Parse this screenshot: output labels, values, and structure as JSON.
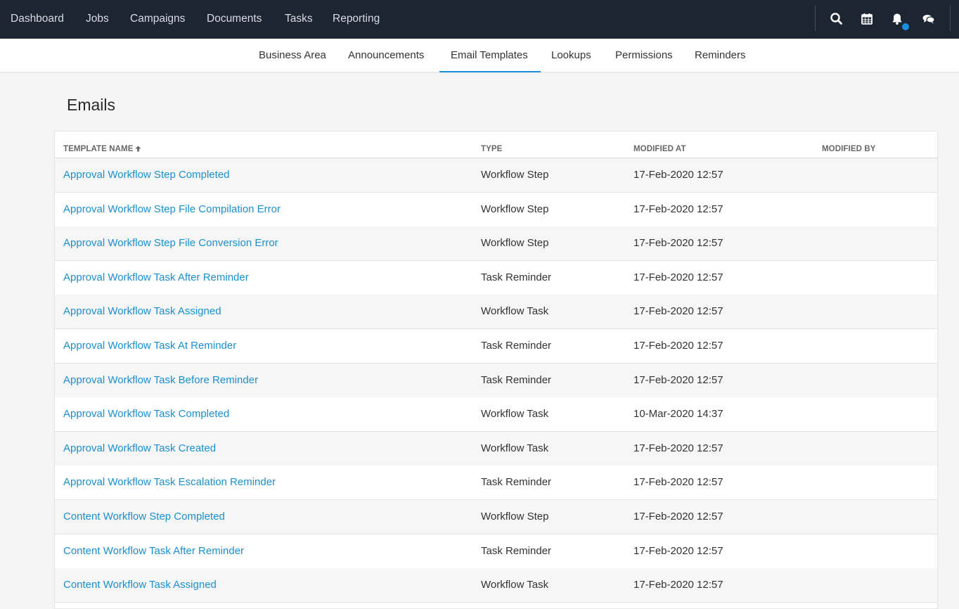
{
  "topnav": {
    "items": [
      "Dashboard",
      "Jobs",
      "Campaigns",
      "Documents",
      "Tasks",
      "Reporting"
    ],
    "icons": [
      "search-icon",
      "calendar-icon",
      "bell-icon",
      "chat-icon"
    ],
    "notification_color": "#1a8fe0"
  },
  "subnav": {
    "tabs": [
      "Business Area",
      "Announcements",
      "Email Templates",
      "Lookups",
      "Permissions",
      "Reminders"
    ],
    "active": "Email Templates",
    "accent": "#1a8fe0"
  },
  "page": {
    "title": "Emails"
  },
  "table": {
    "columns": [
      "TEMPLATE NAME",
      "TYPE",
      "MODIFIED AT",
      "MODIFIED BY"
    ],
    "sort": {
      "column": "TEMPLATE NAME",
      "direction": "ascending"
    },
    "rows": [
      {
        "name": "Approval Workflow Step Completed",
        "type": "Workflow Step",
        "modified_at": "17-Feb-2020 12:57",
        "modified_by": ""
      },
      {
        "name": "Approval Workflow Step File Compilation Error",
        "type": "Workflow Step",
        "modified_at": "17-Feb-2020 12:57",
        "modified_by": ""
      },
      {
        "name": "Approval Workflow Step File Conversion Error",
        "type": "Workflow Step",
        "modified_at": "17-Feb-2020 12:57",
        "modified_by": ""
      },
      {
        "name": "Approval Workflow Task After Reminder",
        "type": "Task Reminder",
        "modified_at": "17-Feb-2020 12:57",
        "modified_by": ""
      },
      {
        "name": "Approval Workflow Task Assigned",
        "type": "Workflow Task",
        "modified_at": "17-Feb-2020 12:57",
        "modified_by": ""
      },
      {
        "name": "Approval Workflow Task At Reminder",
        "type": "Task Reminder",
        "modified_at": "17-Feb-2020 12:57",
        "modified_by": ""
      },
      {
        "name": "Approval Workflow Task Before Reminder",
        "type": "Task Reminder",
        "modified_at": "17-Feb-2020 12:57",
        "modified_by": ""
      },
      {
        "name": "Approval Workflow Task Completed",
        "type": "Workflow Task",
        "modified_at": "10-Mar-2020 14:37",
        "modified_by": ""
      },
      {
        "name": "Approval Workflow Task Created",
        "type": "Workflow Task",
        "modified_at": "17-Feb-2020 12:57",
        "modified_by": ""
      },
      {
        "name": "Approval Workflow Task Escalation Reminder",
        "type": "Task Reminder",
        "modified_at": "17-Feb-2020 12:57",
        "modified_by": ""
      },
      {
        "name": "Content Workflow Step Completed",
        "type": "Workflow Step",
        "modified_at": "17-Feb-2020 12:57",
        "modified_by": ""
      },
      {
        "name": "Content Workflow Task After Reminder",
        "type": "Task Reminder",
        "modified_at": "17-Feb-2020 12:57",
        "modified_by": ""
      },
      {
        "name": "Content Workflow Task Assigned",
        "type": "Workflow Task",
        "modified_at": "17-Feb-2020 12:57",
        "modified_by": ""
      }
    ]
  },
  "colors": {
    "topbar": "#1e2532",
    "link": "#1a8fcf",
    "row_alt": "#f6f6f6"
  }
}
